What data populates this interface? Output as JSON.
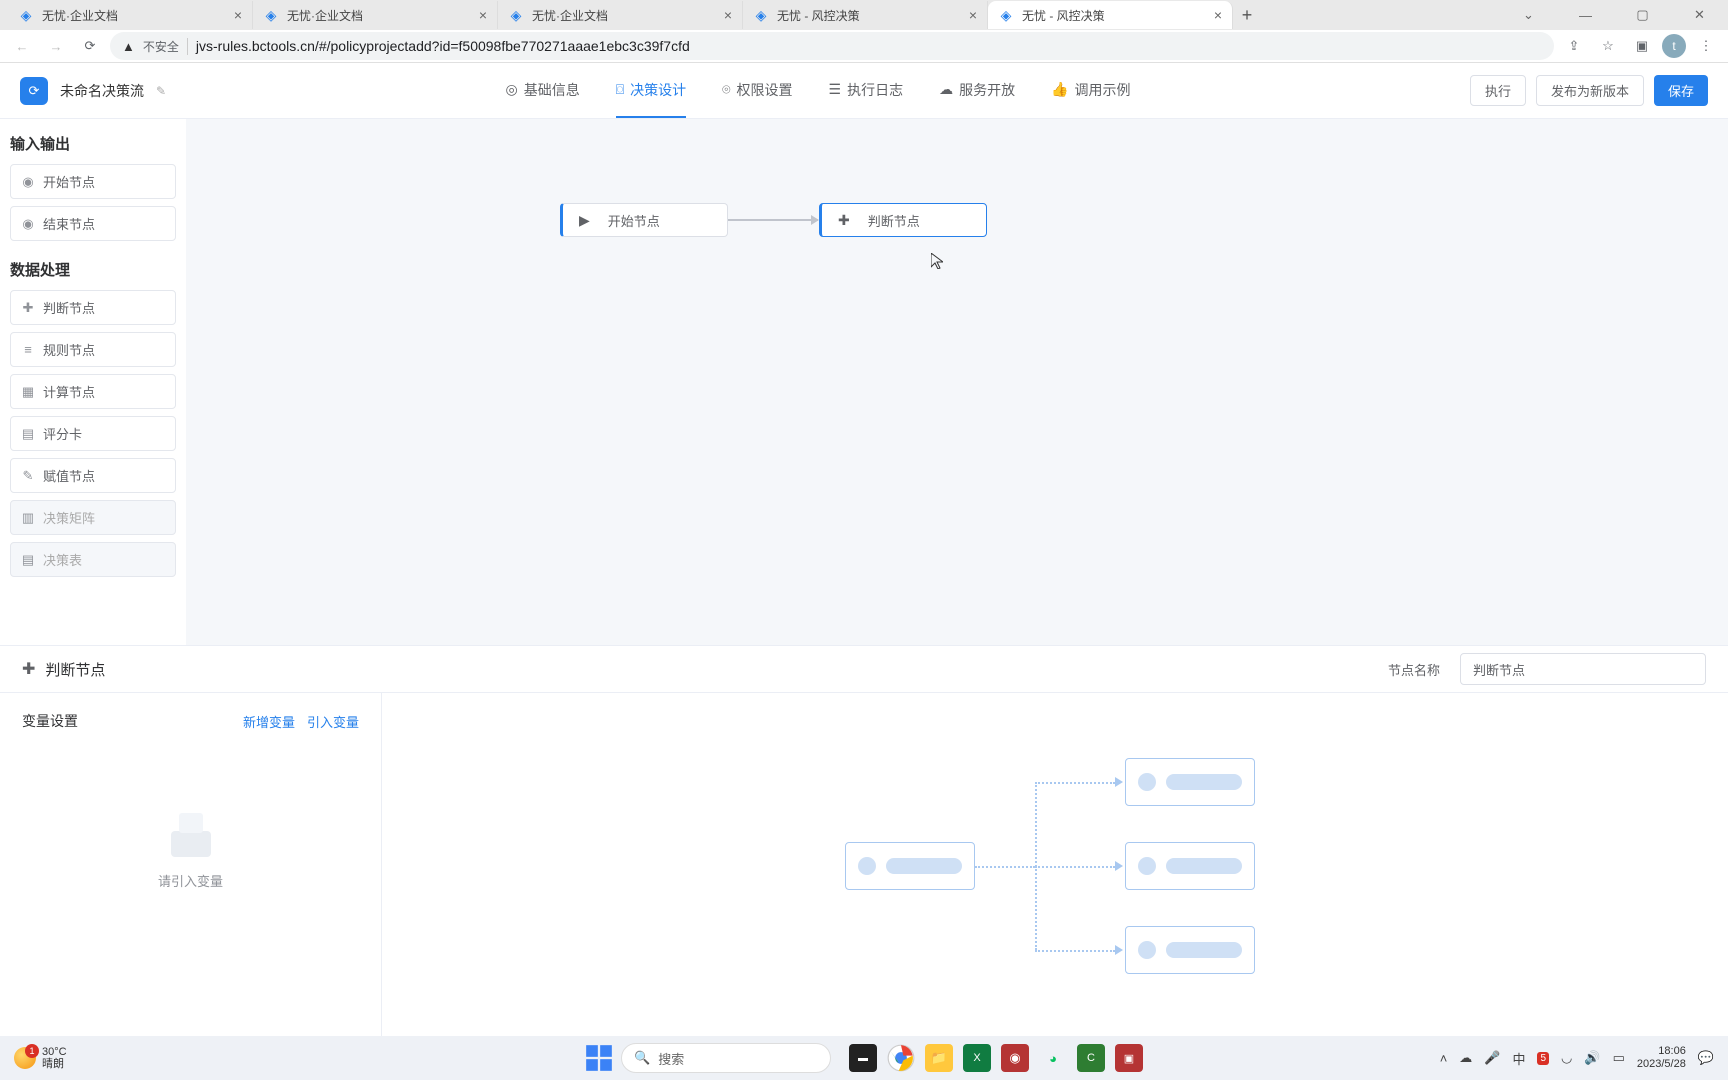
{
  "browser": {
    "tabs": [
      {
        "title": "无忧·企业文档"
      },
      {
        "title": "无忧·企业文档"
      },
      {
        "title": "无忧·企业文档"
      },
      {
        "title": "无忧 - 风控决策"
      },
      {
        "title": "无忧 - 风控决策"
      }
    ],
    "active_tab_index": 4,
    "security_label": "不安全",
    "url": "jvs-rules.bctools.cn/#/policyprojectadd?id=f50098fbe770271aaae1ebc3c39f7cfd",
    "profile_initial": "t"
  },
  "app": {
    "flow_name": "未命名决策流",
    "nav": [
      {
        "icon": "◎",
        "label": "基础信息"
      },
      {
        "icon": "⌼",
        "label": "决策设计"
      },
      {
        "icon": "⌾",
        "label": "权限设置"
      },
      {
        "icon": "☰",
        "label": "执行日志"
      },
      {
        "icon": "☁",
        "label": "服务开放"
      },
      {
        "icon": "👍",
        "label": "调用示例"
      }
    ],
    "active_nav_index": 1,
    "actions": {
      "run": "执行",
      "publish": "发布为新版本",
      "save": "保存"
    }
  },
  "palette": {
    "group_io": "输入输出",
    "group_data": "数据处理",
    "items_io": [
      {
        "icon": "◉",
        "label": "开始节点"
      },
      {
        "icon": "◉",
        "label": "结束节点"
      }
    ],
    "items_data": [
      {
        "icon": "✚",
        "label": "判断节点"
      },
      {
        "icon": "≡",
        "label": "规则节点"
      },
      {
        "icon": "▦",
        "label": "计算节点"
      },
      {
        "icon": "▤",
        "label": "评分卡"
      },
      {
        "icon": "✎",
        "label": "赋值节点"
      },
      {
        "icon": "▥",
        "label": "决策矩阵",
        "disabled": true
      },
      {
        "icon": "▤",
        "label": "决策表",
        "disabled": true
      }
    ]
  },
  "canvas": {
    "nodes": [
      {
        "icon": "▶",
        "label": "开始节点"
      },
      {
        "icon": "✚",
        "label": "判断节点"
      }
    ]
  },
  "bottom": {
    "header_icon_label": "判断节点",
    "node_name_label": "节点名称",
    "node_name_value": "判断节点",
    "var_title": "变量设置",
    "link_add": "新增变量",
    "link_import": "引入变量",
    "empty_text": "请引入变量"
  },
  "taskbar": {
    "weather_temp": "30°C",
    "weather_desc": "晴朗",
    "weather_badge": "1",
    "search_placeholder": "搜索",
    "clock_time": "18:06",
    "clock_date": "2023/5/28"
  }
}
